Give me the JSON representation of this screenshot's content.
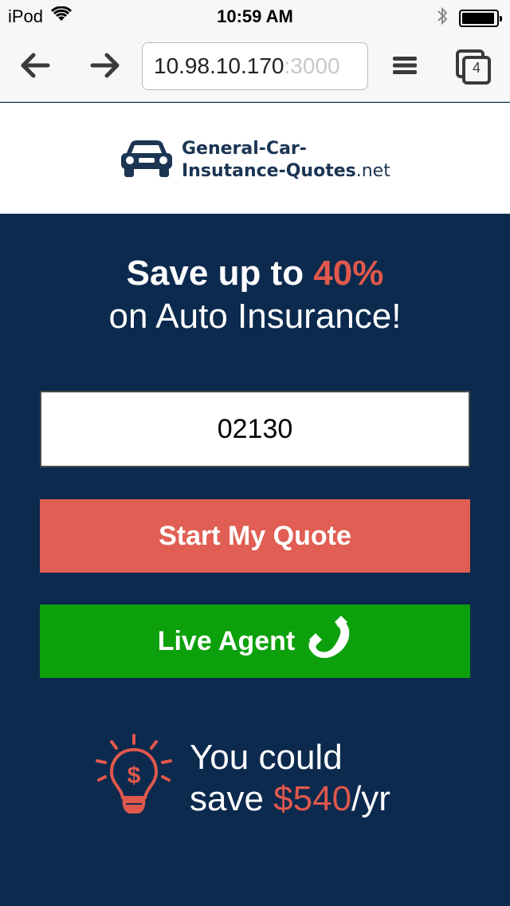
{
  "status_bar": {
    "carrier": "iPod",
    "time": "10:59 AM"
  },
  "browser": {
    "url_host": "10.98.10.170",
    "url_port": ":3000",
    "tab_count": "4"
  },
  "logo": {
    "line1": "General-Car-",
    "line2": "Insutance-Quotes",
    "tld": ".net"
  },
  "hero": {
    "headline_prefix": "Save up to ",
    "headline_accent": "40%",
    "headline_line2": "on Auto Insurance!",
    "zip_value": "02130",
    "quote_button": "Start My Quote",
    "agent_button": "Live Agent",
    "savings_line1": "You could",
    "savings_prefix": "save ",
    "savings_amount": "$540",
    "savings_suffix": "/yr"
  },
  "colors": {
    "navy": "#0c2a4e",
    "accent_red": "#e0584c",
    "button_red": "#e05e53",
    "button_green": "#0ca10c"
  },
  "icons": [
    "wifi-icon",
    "bluetooth-icon",
    "battery-icon",
    "back-arrow-icon",
    "forward-arrow-icon",
    "menu-icon",
    "tabs-icon",
    "car-icon",
    "phone-icon",
    "lightbulb-dollar-icon"
  ]
}
